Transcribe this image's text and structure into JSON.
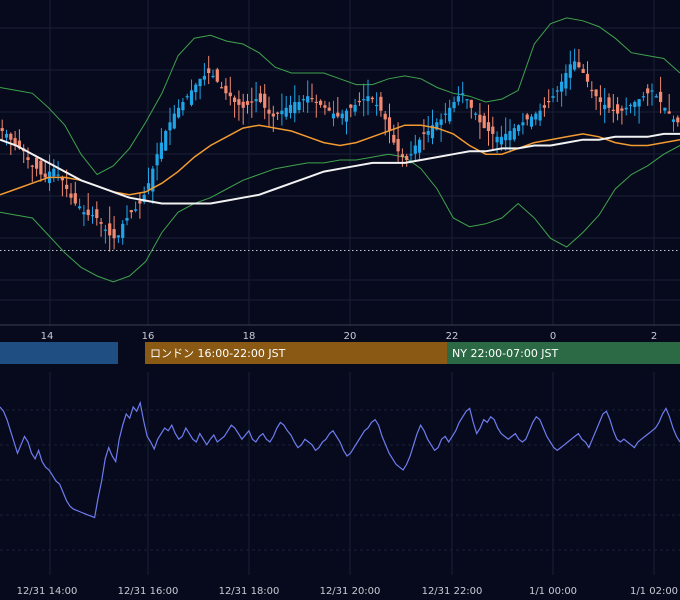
{
  "colors": {
    "background": "#070a1c",
    "grid": "#1a2036",
    "axis_line": "#3a3f52",
    "bull": "#1fa4e8",
    "bear": "#f28a72",
    "sma_fast": "#f39a32",
    "sma_slow": "#f2f2f2",
    "bollinger": "#3fa34d",
    "oscillator": "#6e7cf0",
    "reference_line": "#bfc3cc"
  },
  "chart_data": [
    {
      "type": "candlestick",
      "title": "",
      "x_ticks": [
        "14",
        "16",
        "18",
        "20",
        "22",
        "0",
        "2"
      ],
      "reference_level": 0.188,
      "sessions": [
        {
          "label": "",
          "color": "#1f4f82"
        },
        {
          "label": "ロンドン 16:00-22:00 JST",
          "color": "#8a5a14"
        },
        {
          "label": "NY 22:00-07:00 JST",
          "color": "#2b6a44"
        }
      ],
      "y_range_normalized": [
        0,
        1
      ],
      "series_description": [
        "candles",
        "SMA fast",
        "SMA slow",
        "Bollinger upper",
        "Bollinger lower"
      ],
      "candles_close_normalized": [
        0.6,
        0.59,
        0.57,
        0.55,
        0.54,
        0.53,
        0.5,
        0.48,
        0.47,
        0.45,
        0.44,
        0.46,
        0.47,
        0.45,
        0.43,
        0.4,
        0.37,
        0.35,
        0.34,
        0.32,
        0.31,
        0.31,
        0.3,
        0.28,
        0.26,
        0.24,
        0.23,
        0.24,
        0.28,
        0.3,
        0.32,
        0.33,
        0.35,
        0.38,
        0.42,
        0.47,
        0.52,
        0.56,
        0.6,
        0.63,
        0.66,
        0.68,
        0.7,
        0.72,
        0.74,
        0.76,
        0.78,
        0.79,
        0.8,
        0.79,
        0.77,
        0.75,
        0.73,
        0.72,
        0.7,
        0.69,
        0.68,
        0.69,
        0.7,
        0.71,
        0.7,
        0.68,
        0.66,
        0.65,
        0.66,
        0.67,
        0.68,
        0.69,
        0.7,
        0.7,
        0.71,
        0.72,
        0.71,
        0.7,
        0.69,
        0.68,
        0.67,
        0.66,
        0.65,
        0.66,
        0.67,
        0.68,
        0.69,
        0.7,
        0.71,
        0.72,
        0.71,
        0.69,
        0.67,
        0.64,
        0.6,
        0.56,
        0.53,
        0.51,
        0.5,
        0.52,
        0.55,
        0.57,
        0.59,
        0.6,
        0.62,
        0.63,
        0.64,
        0.66,
        0.68,
        0.7,
        0.72,
        0.73,
        0.71,
        0.68,
        0.66,
        0.63,
        0.61,
        0.6,
        0.59,
        0.58,
        0.58,
        0.59,
        0.6,
        0.61,
        0.62,
        0.63,
        0.64,
        0.65,
        0.66,
        0.67,
        0.68,
        0.7,
        0.72,
        0.74,
        0.77,
        0.8,
        0.83,
        0.84,
        0.82,
        0.8,
        0.77,
        0.74,
        0.72,
        0.7,
        0.69,
        0.68,
        0.67,
        0.66,
        0.67,
        0.68,
        0.69,
        0.7,
        0.71,
        0.72,
        0.73,
        0.74,
        0.72,
        0.7,
        0.68,
        0.66,
        0.64,
        0.63
      ],
      "sma_fast_normalized": [
        0.38,
        0.4,
        0.42,
        0.44,
        0.44,
        0.43,
        0.41,
        0.39,
        0.38,
        0.39,
        0.42,
        0.46,
        0.51,
        0.55,
        0.58,
        0.61,
        0.62,
        0.61,
        0.6,
        0.58,
        0.56,
        0.55,
        0.56,
        0.58,
        0.6,
        0.62,
        0.62,
        0.61,
        0.59,
        0.55,
        0.52,
        0.52,
        0.54,
        0.56,
        0.57,
        0.58,
        0.59,
        0.58,
        0.56,
        0.55,
        0.55,
        0.56,
        0.57
      ],
      "sma_slow_normalized": [
        0.57,
        0.55,
        0.52,
        0.49,
        0.46,
        0.43,
        0.41,
        0.39,
        0.37,
        0.36,
        0.35,
        0.35,
        0.35,
        0.35,
        0.36,
        0.37,
        0.38,
        0.4,
        0.42,
        0.44,
        0.46,
        0.47,
        0.48,
        0.49,
        0.49,
        0.49,
        0.5,
        0.51,
        0.52,
        0.53,
        0.53,
        0.54,
        0.54,
        0.55,
        0.55,
        0.56,
        0.57,
        0.57,
        0.58,
        0.58,
        0.58,
        0.59,
        0.59
      ],
      "boll_upper_normalized": [
        0.75,
        0.74,
        0.73,
        0.68,
        0.62,
        0.52,
        0.45,
        0.48,
        0.54,
        0.63,
        0.73,
        0.86,
        0.92,
        0.93,
        0.91,
        0.9,
        0.87,
        0.82,
        0.8,
        0.8,
        0.8,
        0.78,
        0.76,
        0.76,
        0.78,
        0.79,
        0.78,
        0.75,
        0.73,
        0.72,
        0.7,
        0.71,
        0.74,
        0.9,
        0.97,
        0.99,
        0.98,
        0.96,
        0.92,
        0.87,
        0.86,
        0.85,
        0.8
      ],
      "boll_lower_normalized": [
        0.32,
        0.31,
        0.3,
        0.24,
        0.18,
        0.13,
        0.1,
        0.08,
        0.1,
        0.15,
        0.25,
        0.32,
        0.35,
        0.37,
        0.4,
        0.43,
        0.45,
        0.47,
        0.48,
        0.49,
        0.49,
        0.5,
        0.5,
        0.51,
        0.52,
        0.51,
        0.47,
        0.4,
        0.3,
        0.27,
        0.28,
        0.3,
        0.35,
        0.3,
        0.23,
        0.2,
        0.25,
        0.31,
        0.4,
        0.45,
        0.48,
        0.52,
        0.55
      ]
    },
    {
      "type": "line",
      "title": "",
      "x_ticks": [
        "12/31 14:00",
        "12/31 16:00",
        "12/31 18:00",
        "12/31 20:00",
        "12/31 22:00",
        "1/1 00:00",
        "1/1 02:00"
      ],
      "y_range_normalized": [
        0,
        1
      ],
      "values_normalized": [
        0.95,
        0.92,
        0.86,
        0.78,
        0.7,
        0.62,
        0.68,
        0.74,
        0.7,
        0.62,
        0.58,
        0.64,
        0.56,
        0.52,
        0.5,
        0.46,
        0.42,
        0.4,
        0.34,
        0.28,
        0.24,
        0.22,
        0.21,
        0.2,
        0.19,
        0.18,
        0.17,
        0.16,
        0.3,
        0.42,
        0.58,
        0.66,
        0.6,
        0.56,
        0.72,
        0.82,
        0.9,
        0.87,
        0.95,
        0.92,
        0.98,
        0.85,
        0.74,
        0.7,
        0.65,
        0.72,
        0.76,
        0.8,
        0.78,
        0.82,
        0.76,
        0.72,
        0.74,
        0.8,
        0.76,
        0.72,
        0.7,
        0.76,
        0.72,
        0.68,
        0.72,
        0.75,
        0.7,
        0.72,
        0.74,
        0.78,
        0.82,
        0.8,
        0.76,
        0.72,
        0.75,
        0.78,
        0.72,
        0.7,
        0.74,
        0.76,
        0.72,
        0.7,
        0.74,
        0.8,
        0.84,
        0.82,
        0.78,
        0.75,
        0.7,
        0.66,
        0.68,
        0.72,
        0.7,
        0.68,
        0.64,
        0.66,
        0.7,
        0.72,
        0.76,
        0.78,
        0.74,
        0.7,
        0.64,
        0.6,
        0.62,
        0.66,
        0.7,
        0.74,
        0.78,
        0.8,
        0.84,
        0.86,
        0.82,
        0.74,
        0.68,
        0.62,
        0.58,
        0.54,
        0.52,
        0.5,
        0.54,
        0.6,
        0.68,
        0.76,
        0.82,
        0.78,
        0.72,
        0.68,
        0.64,
        0.66,
        0.72,
        0.74,
        0.7,
        0.74,
        0.78,
        0.84,
        0.88,
        0.92,
        0.94,
        0.84,
        0.76,
        0.8,
        0.86,
        0.84,
        0.88,
        0.86,
        0.8,
        0.76,
        0.74,
        0.72,
        0.74,
        0.76,
        0.72,
        0.7,
        0.72,
        0.78,
        0.84,
        0.88,
        0.86,
        0.8,
        0.74,
        0.7,
        0.66,
        0.64,
        0.66,
        0.68,
        0.7,
        0.72,
        0.74,
        0.76,
        0.72,
        0.7,
        0.66,
        0.72,
        0.78,
        0.84,
        0.9,
        0.92,
        0.86,
        0.78,
        0.72,
        0.7,
        0.72,
        0.7,
        0.68,
        0.66,
        0.7,
        0.72,
        0.74,
        0.76,
        0.78,
        0.8,
        0.84,
        0.9,
        0.94,
        0.88,
        0.8,
        0.74,
        0.7
      ]
    }
  ]
}
